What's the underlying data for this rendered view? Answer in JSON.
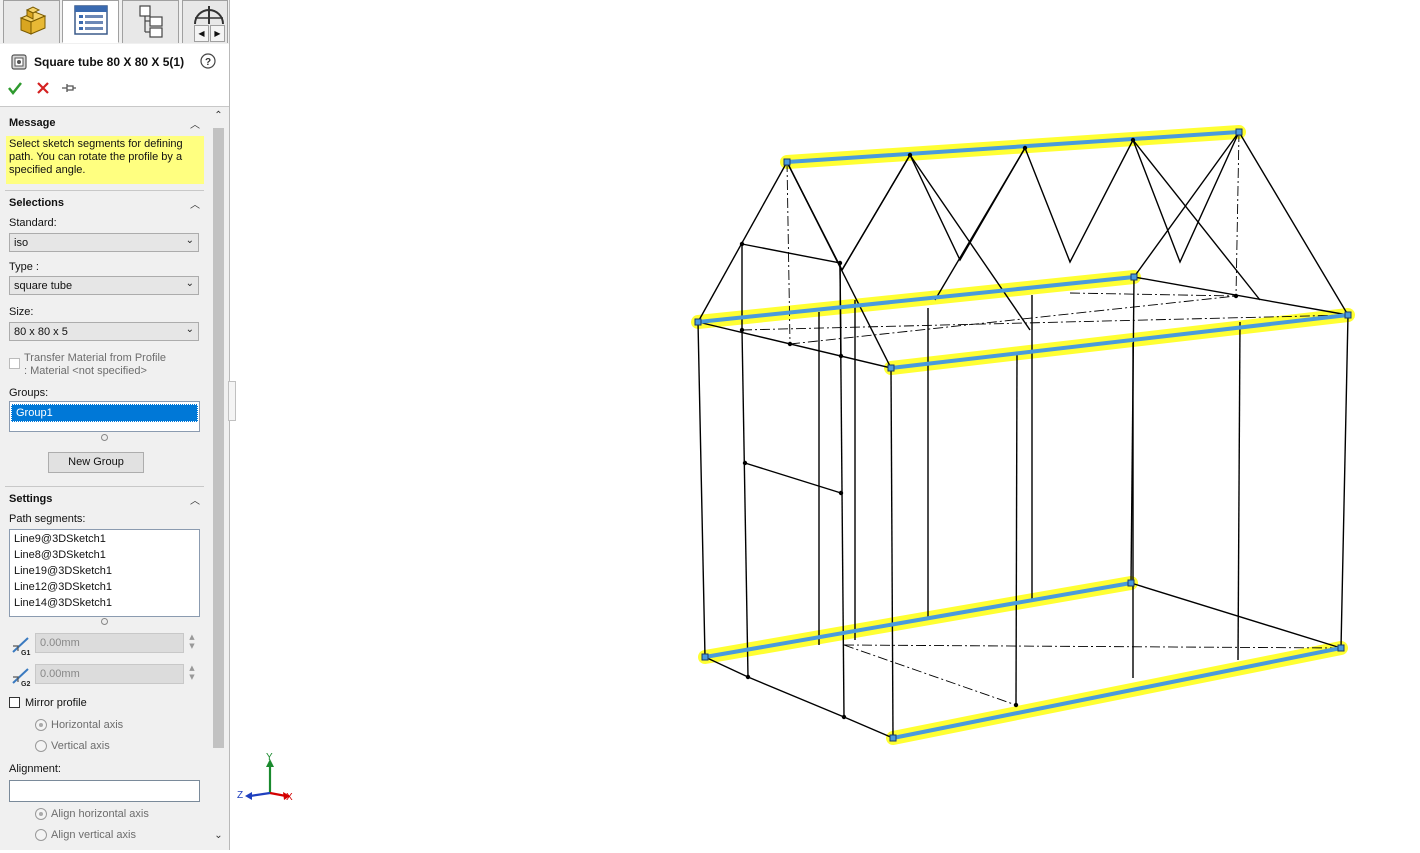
{
  "feature_manager": {
    "tabs": [
      {
        "name": "part-icon"
      },
      {
        "name": "property-manager-icon"
      },
      {
        "name": "config-manager-icon"
      },
      {
        "name": "dimxpert-icon"
      }
    ],
    "title": "Square tube 80 X 80 X 5(1)",
    "help_icon": "help-icon",
    "ok_icon": "checkmark-icon",
    "cancel_icon": "close-icon",
    "pin_icon": "pushpin-icon"
  },
  "message": {
    "header": "Message",
    "text": "Select sketch segments for defining path. You can rotate the profile by a specified angle."
  },
  "selections": {
    "header": "Selections",
    "standard_label": "Standard:",
    "standard_value": "iso",
    "type_label": "Type :",
    "type_value": "square tube",
    "size_label": "Size:",
    "size_value": "80 x 80 x 5",
    "transfer_label_1": "Transfer Material from Profile",
    "transfer_label_2": ": Material <not specified>",
    "groups_label": "Groups:",
    "groups": [
      "Group1"
    ],
    "new_group_label": "New Group"
  },
  "settings": {
    "header": "Settings",
    "path_segments_label": "Path segments:",
    "path_segments": [
      "Line9@3DSketch1",
      "Line8@3DSketch1",
      "Line19@3DSketch1",
      "Line12@3DSketch1",
      "Line14@3DSketch1"
    ],
    "offset1_value": "0.00mm",
    "offset2_value": "0.00mm",
    "offset1_icon_label": "G1",
    "offset2_icon_label": "G2",
    "mirror_label": "Mirror profile",
    "horizontal_axis_label": "Horizontal axis",
    "vertical_axis_label": "Vertical axis",
    "alignment_label": "Alignment:",
    "alignment_value": "",
    "align_horizontal_label": "Align horizontal axis",
    "align_vertical_label": "Align vertical axis"
  },
  "triad": {
    "x_label": "X",
    "y_label": "Y",
    "z_label": "Z",
    "colors": {
      "x": "#d40000",
      "y": "#1a8a2e",
      "z": "#1e3fbf"
    }
  },
  "colors": {
    "highlight": "#ffff33",
    "path_line": "#4a9bdc",
    "sketch_line": "#000000",
    "message_bg": "#ffff80",
    "selected_row": "#0078d7"
  }
}
